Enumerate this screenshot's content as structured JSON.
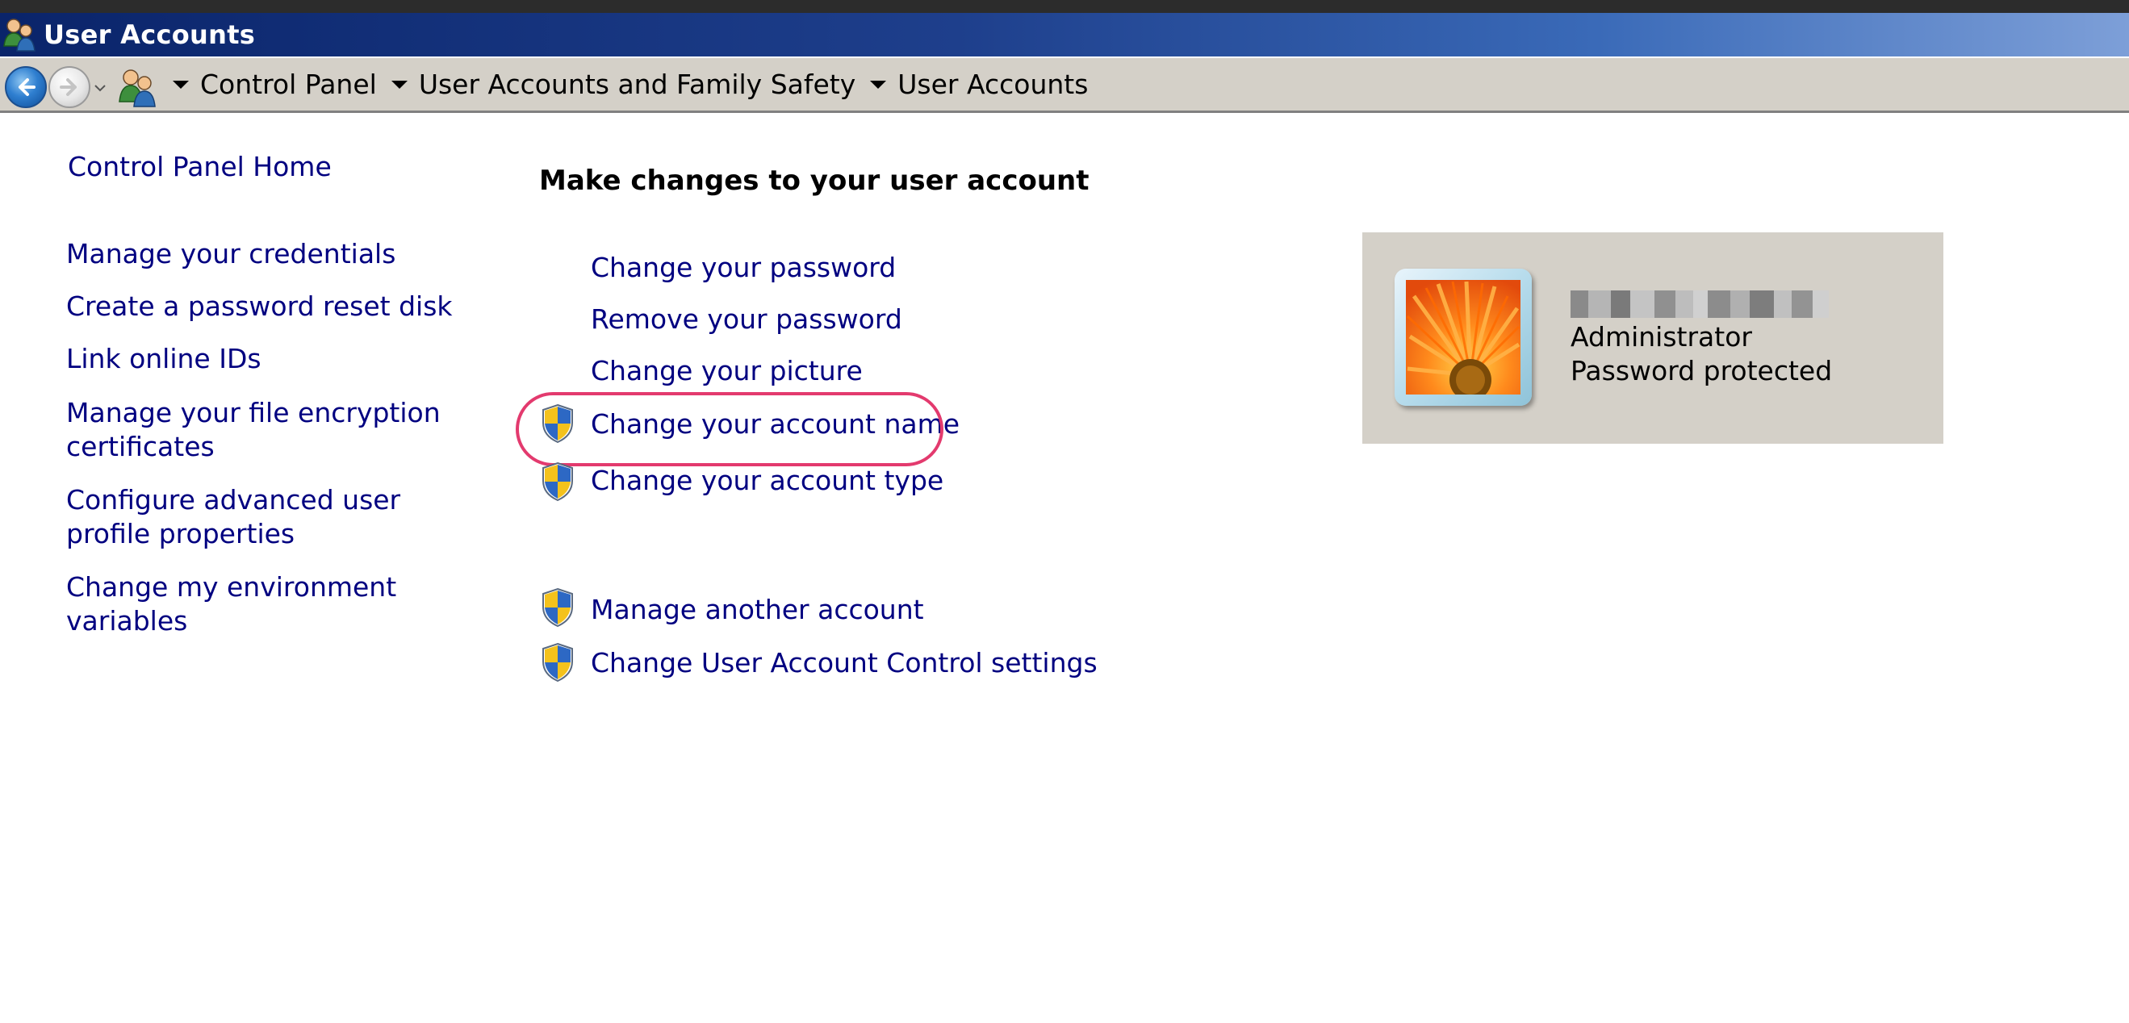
{
  "window": {
    "title": "User Accounts",
    "title_icon": "user-accounts-icon"
  },
  "address_bar": {
    "back_icon": "back-arrow-icon",
    "forward_icon": "forward-arrow-icon",
    "crumbs": [
      "Control Panel",
      "User Accounts and Family Safety",
      "User Accounts"
    ]
  },
  "left_pane": {
    "home": "Control Panel Home",
    "links": [
      "Manage your credentials",
      "Create a password reset disk",
      "Link online IDs",
      "Manage your file encryption certificates",
      "Configure advanced user profile properties",
      "Change my environment variables"
    ]
  },
  "main": {
    "heading": "Make changes to your user account",
    "tasks": [
      "Change your password",
      "Remove your password",
      "Change your picture",
      "Change your account name",
      "Change your account type"
    ],
    "other_tasks": [
      "Manage another account",
      "Change User Account Control settings"
    ]
  },
  "user_card": {
    "account_type": "Administrator",
    "status": "Password protected"
  },
  "colors": {
    "link": "#000080",
    "highlight": "#e33a6e",
    "panel": "#d4d0c8"
  }
}
